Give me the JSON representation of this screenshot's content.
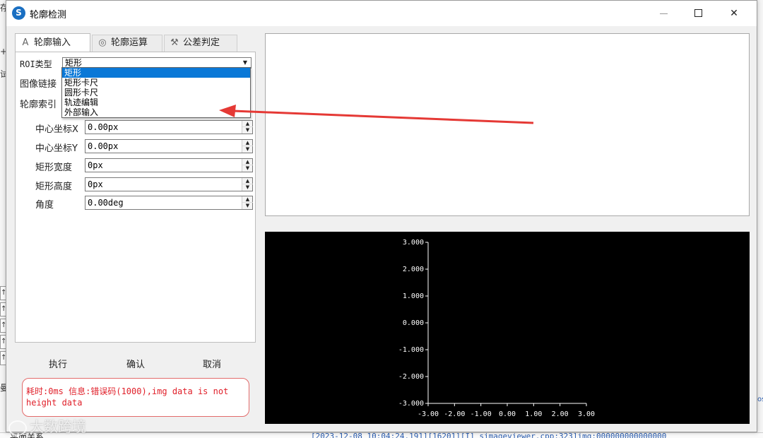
{
  "window": {
    "title": "轮廓检测",
    "app_icon_glyph": "S",
    "controls": {
      "minimize": "minimize-icon",
      "maximize": "maximize-icon",
      "close": "close-icon"
    }
  },
  "tabs": [
    {
      "label": "轮廓输入",
      "icon": "outline-a-icon",
      "glyph": "A",
      "active": true
    },
    {
      "label": "轮廓运算",
      "icon": "concentric-circle-icon",
      "glyph": "◎",
      "active": false
    },
    {
      "label": "公差判定",
      "icon": "hammer-icon",
      "glyph": "⚒",
      "active": false
    }
  ],
  "form": {
    "roi_type_label": "ROI类型",
    "roi_type_value": "矩形",
    "image_link_label": "图像链接",
    "contour_index_label": "轮廓索引"
  },
  "dropdown": {
    "options": [
      "矩形",
      "矩形卡尺",
      "圆形卡尺",
      "轨迹编辑",
      "外部输入"
    ],
    "selected_index": 0
  },
  "fields": [
    {
      "label": "中心坐标X",
      "value": "0.00px"
    },
    {
      "label": "中心坐标Y",
      "value": "0.00px"
    },
    {
      "label": "矩形宽度",
      "value": "0px"
    },
    {
      "label": "矩形高度",
      "value": "0px"
    },
    {
      "label": "角度",
      "value": "0.00deg"
    }
  ],
  "actions": {
    "execute": "执行",
    "confirm": "确认",
    "cancel": "取消"
  },
  "status": {
    "text": "耗时:0ms 信息:错误码(1000),img data is not height data",
    "color": "#e0202a"
  },
  "chart_data": {
    "type": "line",
    "series": [],
    "x_ticks": [
      "-3.00",
      "-2.00",
      "-1.00",
      "0.00",
      "1.00",
      "2.00",
      "3.00"
    ],
    "y_ticks": [
      "3.000",
      "2.000",
      "1.000",
      "0.000",
      "-1.000",
      "-2.000",
      "-3.000"
    ],
    "xlim": [
      -3,
      3
    ],
    "ylim": [
      -3,
      3
    ],
    "background": "#000000",
    "axis_color": "#ffffff"
  },
  "background_app": {
    "left_fragment_top": "存",
    "left_fragment_mid": "试",
    "left_fragment_plus": "+",
    "left_fragment_bottom": "曼",
    "bottom_fragment": "平面关系",
    "log_line": "[2023-12-08 10:04:24.191][16201][I] simageviewer.cpp:323]img:000000000000000",
    "right_fragment": "os"
  },
  "watermark": "大数跨境",
  "annotation": {
    "arrow_color": "#e53935"
  }
}
